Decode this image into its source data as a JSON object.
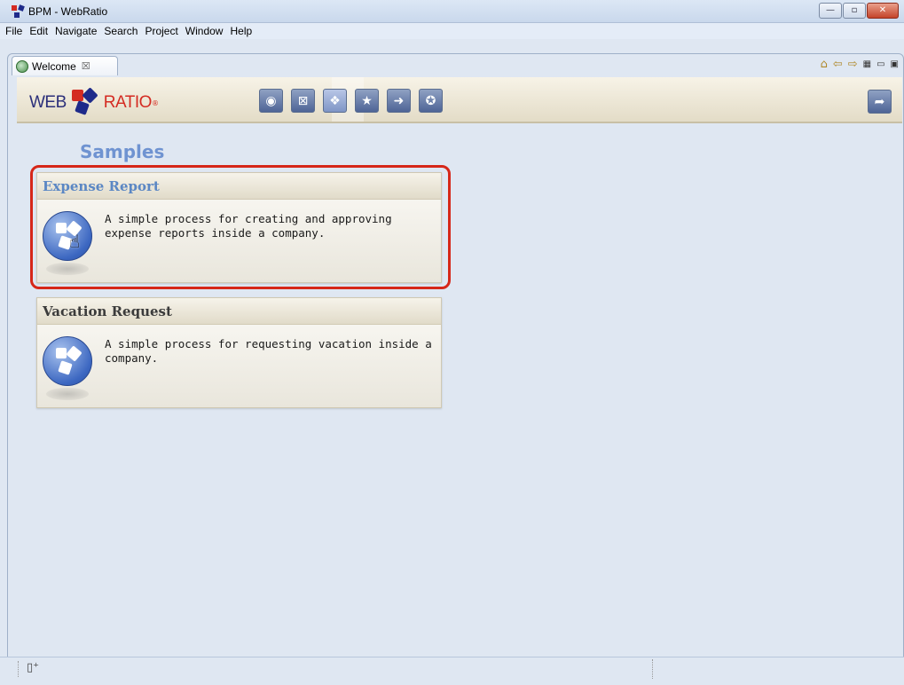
{
  "window": {
    "title": "BPM - WebRatio",
    "minimize_glyph": "—",
    "maximize_glyph": "▫",
    "close_glyph": "✕"
  },
  "menubar": {
    "items": [
      "File",
      "Edit",
      "Navigate",
      "Search",
      "Project",
      "Window",
      "Help"
    ]
  },
  "editor": {
    "tab_label": "Welcome",
    "tab_close": "☒",
    "tools": {
      "home": "⌂",
      "back": "⇦",
      "forward": "⇨",
      "customize": "▦",
      "minimize": "▭",
      "restore": "▣"
    }
  },
  "welcome_header": {
    "logo_web": "WEB",
    "logo_ratio": "RATIO",
    "logo_reg": "®",
    "nav_icons": [
      {
        "name": "overview-icon",
        "glyph": "◉"
      },
      {
        "name": "tutorials-icon",
        "glyph": "⊠"
      },
      {
        "name": "samples-icon",
        "glyph": "❖"
      },
      {
        "name": "whats-new-icon",
        "glyph": "★"
      },
      {
        "name": "first-steps-icon",
        "glyph": "➜"
      },
      {
        "name": "web-resources-icon",
        "glyph": "✪"
      }
    ],
    "exit_glyph": "➦"
  },
  "samples": {
    "title": "Samples",
    "cards": [
      {
        "title": "Expense Report",
        "description": "A simple process for creating and approving expense reports inside a company."
      },
      {
        "title": "Vacation Request",
        "description": "A simple process for requesting vacation inside a company."
      }
    ]
  },
  "statusbar": {
    "icon": "▯⁺"
  },
  "colors": {
    "accent_blue": "#6f93d1",
    "highlight_red": "#d62719",
    "card_title_blue": "#5b87c4"
  }
}
